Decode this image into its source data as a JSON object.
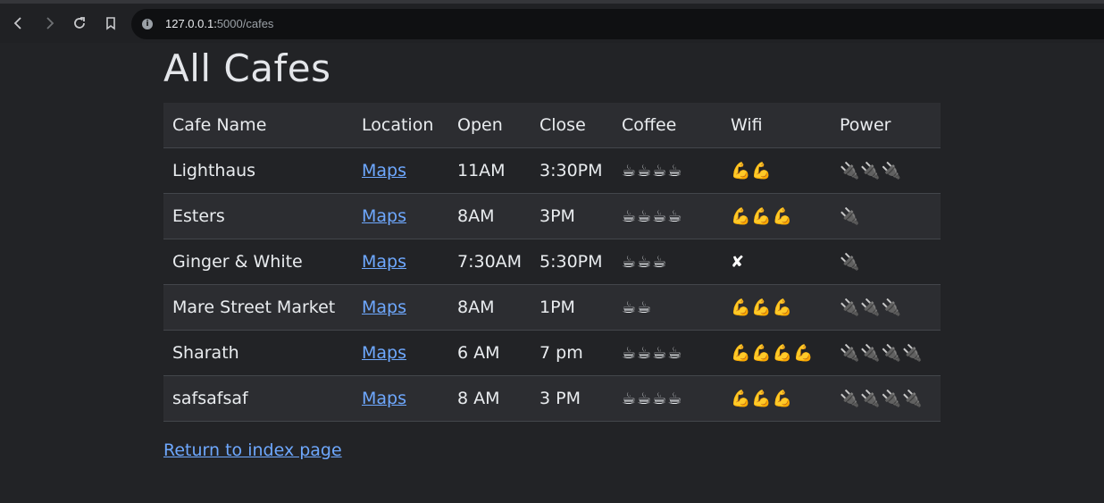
{
  "browser": {
    "url_host": "127.0.0.1:",
    "url_path": "5000/cafes"
  },
  "page": {
    "title": "All Cafes",
    "return_link": "Return to index page"
  },
  "table": {
    "headers": [
      "Cafe Name",
      "Location",
      "Open",
      "Close",
      "Coffee",
      "Wifi",
      "Power"
    ],
    "rows": [
      {
        "name": "Lighthaus",
        "location": "Maps",
        "open": "11AM",
        "close": "3:30PM",
        "coffee": "☕☕☕☕",
        "wifi": "💪💪",
        "power": "🔌🔌🔌"
      },
      {
        "name": "Esters",
        "location": "Maps",
        "open": "8AM",
        "close": "3PM",
        "coffee": "☕☕☕☕",
        "wifi": "💪💪💪",
        "power": "🔌"
      },
      {
        "name": "Ginger & White",
        "location": "Maps",
        "open": "7:30AM",
        "close": "5:30PM",
        "coffee": "☕☕☕",
        "wifi": "✘",
        "power": "🔌"
      },
      {
        "name": "Mare Street Market",
        "location": "Maps",
        "open": "8AM",
        "close": "1PM",
        "coffee": "☕☕",
        "wifi": "💪💪💪",
        "power": "🔌🔌🔌"
      },
      {
        "name": "Sharath",
        "location": "Maps",
        "open": "6 AM",
        "close": "7 pm",
        "coffee": "☕☕☕☕",
        "wifi": "💪💪💪💪",
        "power": "🔌🔌🔌🔌"
      },
      {
        "name": "safsafsaf",
        "location": "Maps",
        "open": "8 AM",
        "close": "3 PM",
        "coffee": "☕☕☕☕",
        "wifi": "💪💪💪",
        "power": "🔌🔌🔌🔌"
      }
    ]
  }
}
